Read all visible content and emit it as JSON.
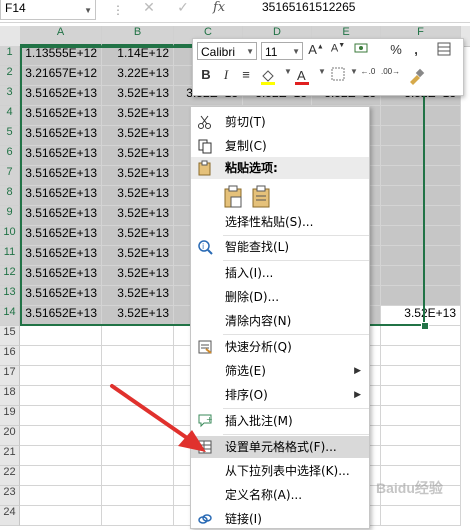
{
  "formula_bar": {
    "name_box": "F14",
    "value": "35165161512265"
  },
  "columns": [
    "A",
    "B",
    "C",
    "D",
    "E",
    "F"
  ],
  "rows": [
    {
      "n": "1",
      "a": "1.13555E+12",
      "b": "1.14E+12",
      "c": "1.1"
    },
    {
      "n": "2",
      "a": "3.21657E+12",
      "b": "3.22E+13",
      "c": "3.2"
    },
    {
      "n": "3",
      "a": "3.51652E+13",
      "b": "3.52E+13",
      "c": "3.52E+13",
      "d": "3.52E+13",
      "e": "3.52E+13",
      "f": "3.52E+13"
    },
    {
      "n": "4",
      "a": "3.51652E+13",
      "b": "3.52E+13",
      "c": "3.5"
    },
    {
      "n": "5",
      "a": "3.51652E+13",
      "b": "3.52E+13",
      "c": "3.5"
    },
    {
      "n": "6",
      "a": "3.51652E+13",
      "b": "3.52E+13",
      "c": "3.5"
    },
    {
      "n": "7",
      "a": "3.51652E+13",
      "b": "3.52E+13",
      "c": "3.5"
    },
    {
      "n": "8",
      "a": "3.51652E+13",
      "b": "3.52E+13",
      "c": "3.5"
    },
    {
      "n": "9",
      "a": "3.51652E+13",
      "b": "3.52E+13",
      "c": "3.5"
    },
    {
      "n": "10",
      "a": "3.51652E+13",
      "b": "3.52E+13",
      "c": "3.5"
    },
    {
      "n": "11",
      "a": "3.51652E+13",
      "b": "3.52E+13",
      "c": "3.5"
    },
    {
      "n": "12",
      "a": "3.51652E+13",
      "b": "3.52E+13",
      "c": "3.5"
    },
    {
      "n": "13",
      "a": "3.51652E+13",
      "b": "3.52E+13",
      "c": "3.5"
    },
    {
      "n": "14",
      "a": "3.51652E+13",
      "b": "3.52E+13",
      "c": "3.5",
      "f": "3.52E+13"
    },
    {
      "n": "15"
    },
    {
      "n": "16"
    },
    {
      "n": "17"
    },
    {
      "n": "18"
    },
    {
      "n": "19"
    },
    {
      "n": "20"
    },
    {
      "n": "21"
    },
    {
      "n": "22"
    },
    {
      "n": "23"
    },
    {
      "n": "24"
    }
  ],
  "mini_toolbar": {
    "font": "Calibri",
    "size": "11",
    "bold": "B",
    "italic": "I",
    "percent": "%",
    "comma": ","
  },
  "context_menu": {
    "cut": "剪切(T)",
    "copy": "复制(C)",
    "paste_options": "粘贴选项:",
    "paste_special": "选择性粘贴(S)...",
    "smart_lookup": "智能查找(L)",
    "insert": "插入(I)...",
    "delete": "删除(D)...",
    "clear": "清除内容(N)",
    "quick_analysis": "快速分析(Q)",
    "filter": "筛选(E)",
    "sort": "排序(O)",
    "insert_comment": "插入批注(M)",
    "format_cells": "设置单元格格式(F)...",
    "pick_list": "从下拉列表中选择(K)...",
    "define_name": "定义名称(A)...",
    "link": "链接(I)"
  },
  "colors": {
    "selection": "#217346",
    "arrow": "#e0312d"
  },
  "watermark": "Baidu经验"
}
